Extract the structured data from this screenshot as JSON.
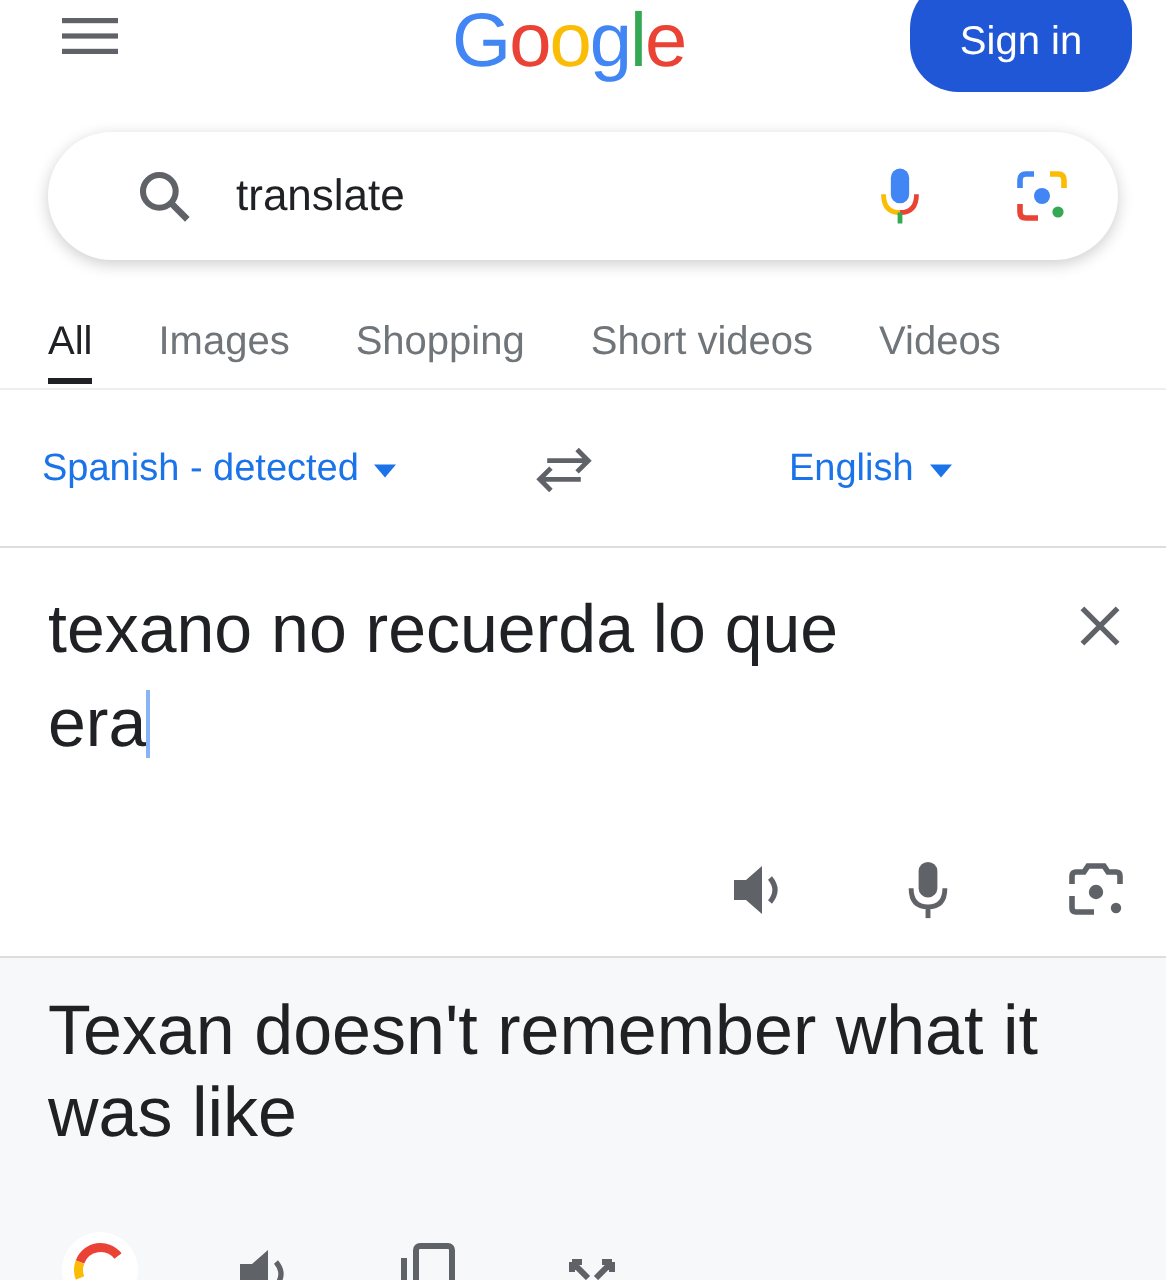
{
  "header": {
    "logo": [
      {
        "char": "G",
        "color": "#4285f4"
      },
      {
        "char": "o",
        "color": "#ea4335"
      },
      {
        "char": "o",
        "color": "#fbbc05"
      },
      {
        "char": "g",
        "color": "#4285f4"
      },
      {
        "char": "l",
        "color": "#34a853"
      },
      {
        "char": "e",
        "color": "#ea4335"
      }
    ],
    "sign_in": "Sign in"
  },
  "search": {
    "value": "translate"
  },
  "tabs": [
    {
      "label": "All",
      "selected": true
    },
    {
      "label": "Images",
      "selected": false
    },
    {
      "label": "Shopping",
      "selected": false
    },
    {
      "label": "Short videos",
      "selected": false
    },
    {
      "label": "Videos",
      "selected": false
    }
  ],
  "translator": {
    "source_language": "Spanish - detected",
    "target_language": "English",
    "input": "texano no recuerda lo que era",
    "output": "Texan doesn't remember what it was like"
  }
}
